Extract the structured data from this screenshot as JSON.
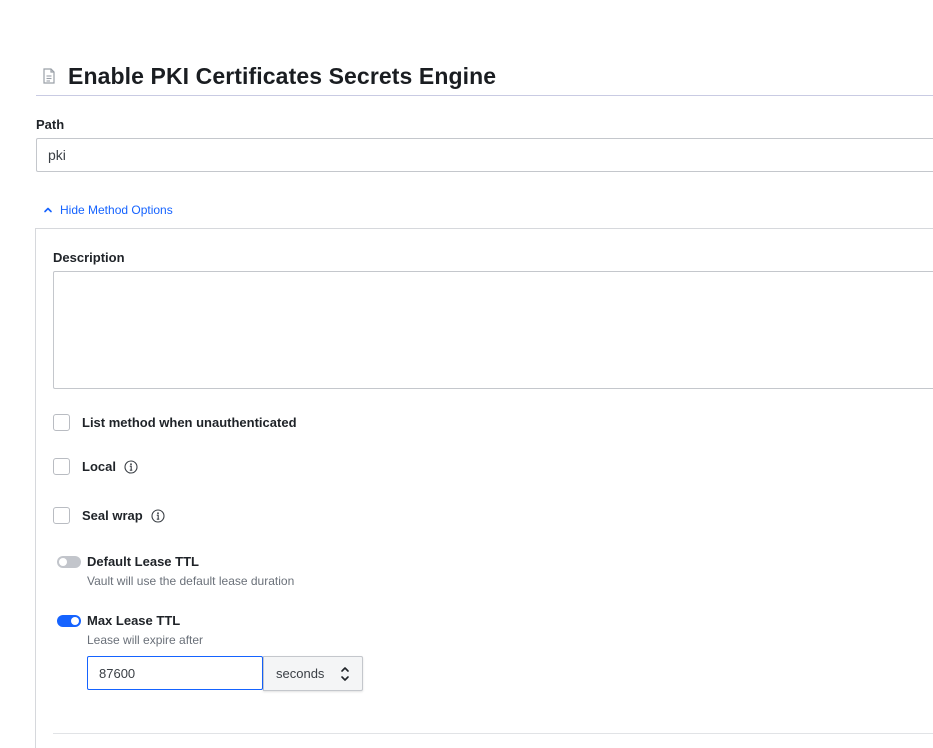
{
  "page": {
    "title": "Enable PKI Certificates Secrets Engine",
    "title_icon": "document-icon"
  },
  "path": {
    "label": "Path",
    "value": "pki"
  },
  "method_options": {
    "toggle_label": "Hide Method Options",
    "toggle_icon": "chevron-up-icon"
  },
  "description": {
    "label": "Description",
    "value": ""
  },
  "checkboxes": {
    "list_unauth": {
      "label": "List method when unauthenticated",
      "checked": false
    },
    "local": {
      "label": "Local",
      "checked": false,
      "icon": "info-icon"
    },
    "seal_wrap": {
      "label": "Seal wrap",
      "checked": false,
      "icon": "info-icon"
    }
  },
  "default_lease_ttl": {
    "label": "Default Lease TTL",
    "help": "Vault will use the default lease duration",
    "enabled": false
  },
  "max_lease_ttl": {
    "label": "Max Lease TTL",
    "help": "Lease will expire after",
    "enabled": true,
    "value": "87600",
    "unit": "seconds"
  },
  "colors": {
    "accent": "#1563ff",
    "border": "#c4c7cc",
    "muted_text": "#6a7079"
  }
}
